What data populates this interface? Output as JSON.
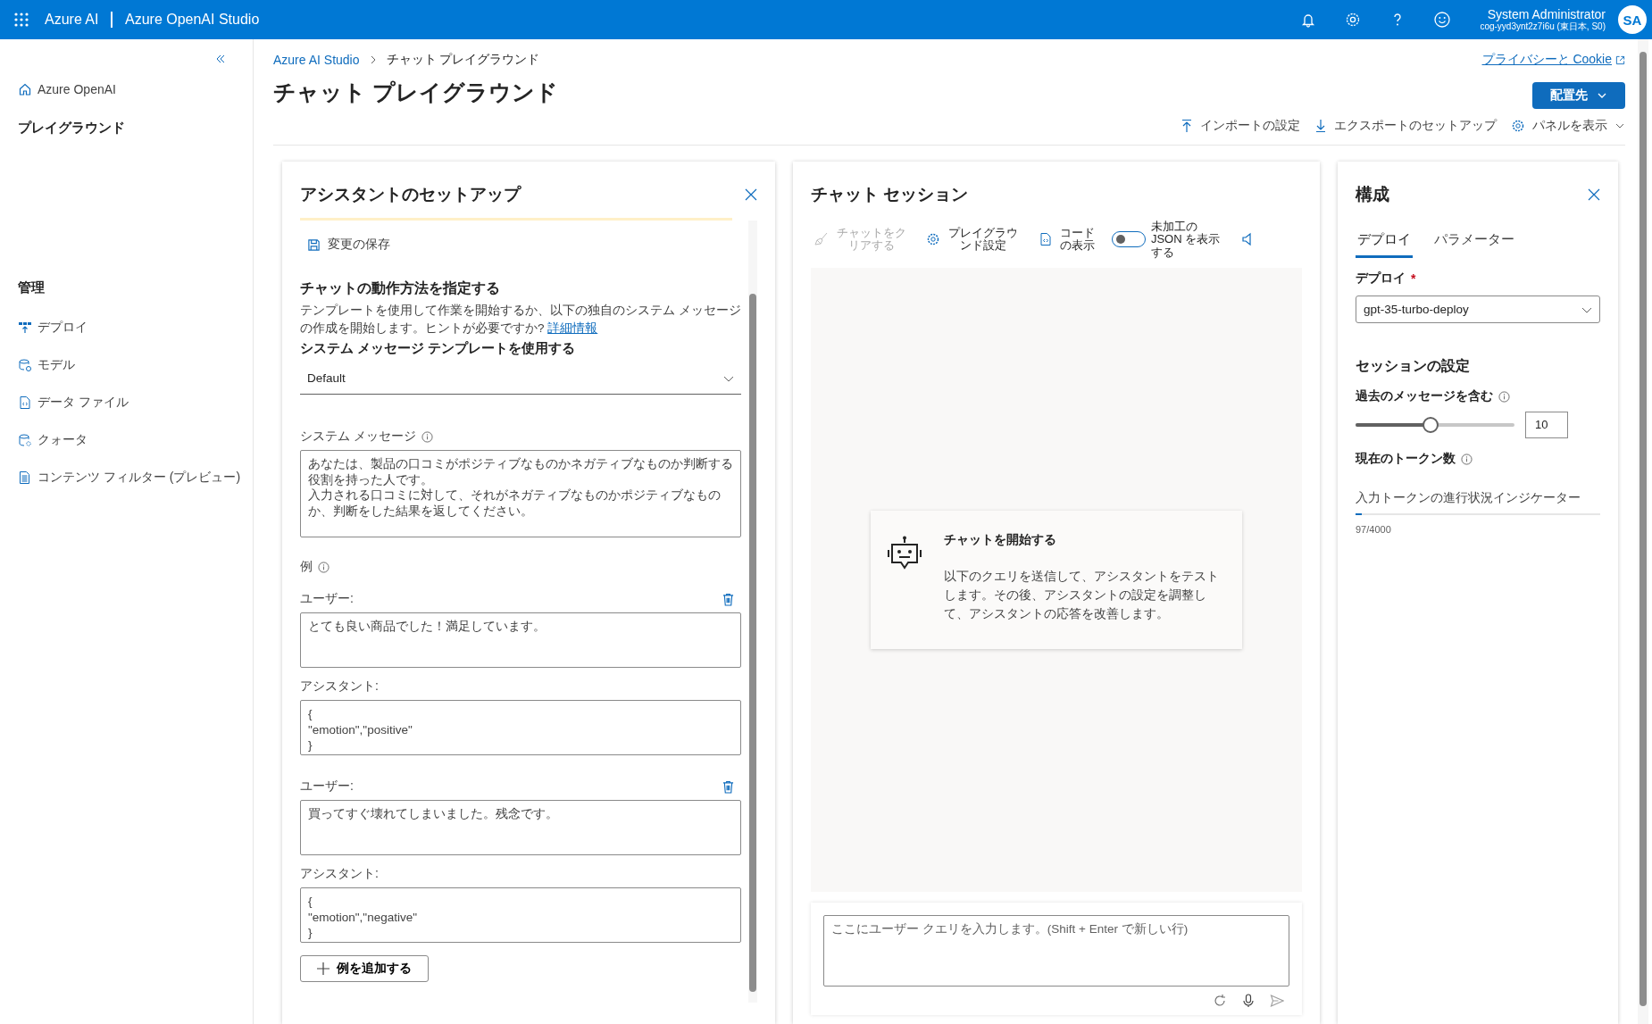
{
  "header": {
    "app_name": "Azure AI",
    "product": "Azure OpenAI Studio",
    "user_name": "System Administrator",
    "user_resource": "cog-yyd3ynt2z7i6u (東日本, S0)",
    "avatar_initials": "SA"
  },
  "sidebar": {
    "home": "Azure OpenAI",
    "section_title": "プレイグラウンド",
    "group_title": "管理",
    "items": [
      {
        "label": "デプロイ"
      },
      {
        "label": "モデル"
      },
      {
        "label": "データ ファイル"
      },
      {
        "label": "クォータ"
      },
      {
        "label": "コンテンツ フィルター (プレビュー)"
      }
    ]
  },
  "page": {
    "breadcrumb": [
      {
        "label": "Azure AI Studio",
        "kind": "link"
      },
      {
        "label": "チャット プレイグラウンド",
        "kind": "current"
      }
    ],
    "title": "チャット プレイグラウンド",
    "privacy_link": "プライバシーと Cookie",
    "deploy_button": "配置先",
    "actions": [
      "インポートの設定",
      "エクスポートのセットアップ",
      "パネルを表示"
    ]
  },
  "setup": {
    "title": "アシスタントのセットアップ",
    "save": "変更の保存",
    "heading": "チャットの動作方法を指定する",
    "description": "テンプレートを使用して作業を開始するか、以下の独自のシステム メッセージの作成を開始します。ヒントが必要ですか?",
    "learn_more": "詳細情報",
    "template_label": "システム メッセージ テンプレートを使用する",
    "template_value": "Default",
    "system_label": "システム メッセージ",
    "system_text": [
      "あなたは、製品の口コミがポジティブなものかネガティブなものか判断する役割を持った人です。",
      "入力される口コミに対して、それがネガティブなものかポジティブなものか、判断をした結果を返してください。"
    ],
    "examples_label": "例",
    "examples": [
      {
        "user_label": "ユーザー:",
        "user_text": "とても良い商品でした！満足しています。",
        "assistant_label": "アシスタント:",
        "assistant_text": "{\n\"emotion\",\"positive\"\n}"
      },
      {
        "user_label": "ユーザー:",
        "user_text": "買ってすぐ壊れてしまいました。残念です。",
        "assistant_label": "アシスタント:",
        "assistant_text": "{\n\"emotion\",\"negative\"\n}"
      }
    ],
    "add_example": "例を追加する"
  },
  "chat": {
    "title": "チャット セッション",
    "toolbar": [
      {
        "kind": "clear",
        "label": "チャットをクリアする",
        "disabled": true
      },
      {
        "kind": "settings",
        "label": "プレイグラウンド設定",
        "disabled": false
      },
      {
        "kind": "code",
        "label": "コードの表示",
        "disabled": false
      },
      {
        "kind": "toggle",
        "label": "未加工の JSON を表示する",
        "on": false
      }
    ],
    "empty_title": "チャットを開始する",
    "empty_text": "以下のクエリを送信して、アシスタントをテストします。その後、アシスタントの設定を調整して、アシスタントの応答を改善します。",
    "input_placeholder": "ここにユーザー クエリを入力します。(Shift + Enter で新しい行)"
  },
  "config": {
    "title": "構成",
    "tabs": [
      {
        "label": "デプロイ",
        "selected": true
      },
      {
        "label": "パラメーター",
        "selected": false
      }
    ],
    "deploy_label": "デプロイ",
    "required_mark": "*",
    "deploy_value": "gpt-35-turbo-deploy",
    "session_title": "セッションの設定",
    "past_messages_label": "過去のメッセージを含む",
    "past_messages": {
      "level": 0.47,
      "value": "10"
    },
    "token_label": "現在のトークン数",
    "token_progress_label": "入力トークンの進行状況インジケーター",
    "token_progress": {
      "level": 0.024
    },
    "token_count": "97/4000"
  }
}
